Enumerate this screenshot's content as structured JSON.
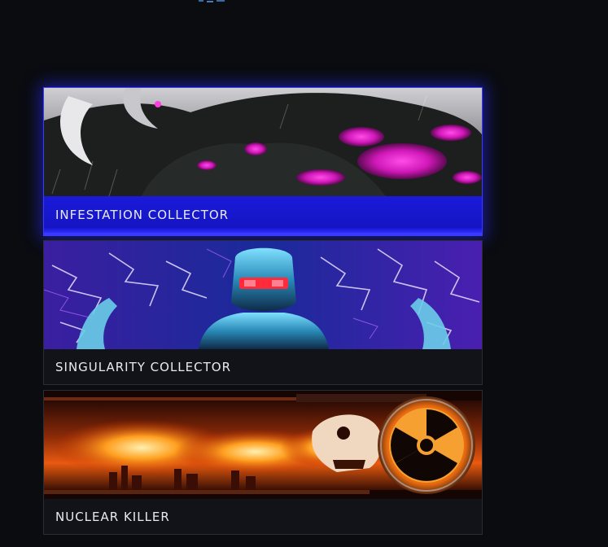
{
  "theme": {
    "background": "#0a0c10",
    "selected_accent": "#1a1ad8",
    "card_border": "#2a2d35"
  },
  "cards": [
    {
      "label": "INFESTATION COLLECTOR",
      "selected": true,
      "art": "infestation-collector-banner"
    },
    {
      "label": "SINGULARITY COLLECTOR",
      "selected": false,
      "art": "singularity-collector-banner"
    },
    {
      "label": "NUCLEAR KILLER",
      "selected": false,
      "art": "nuclear-killer-banner"
    }
  ]
}
